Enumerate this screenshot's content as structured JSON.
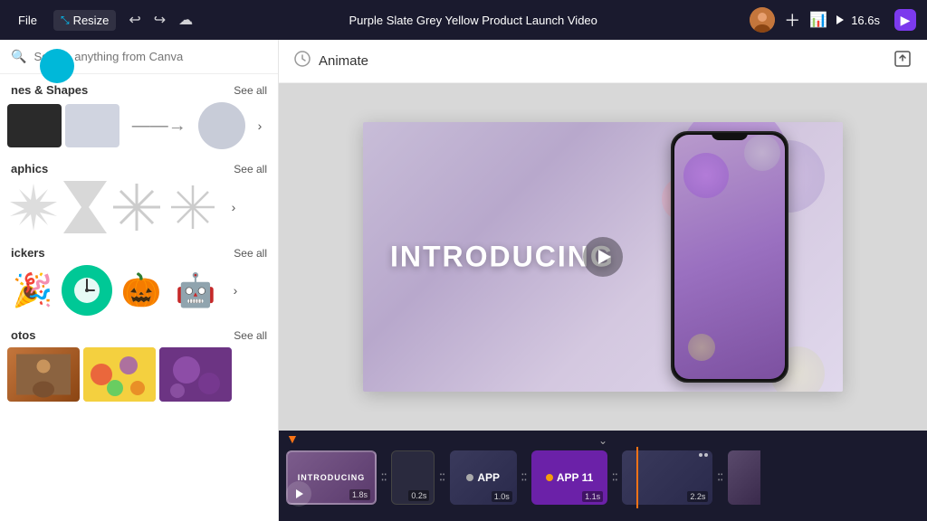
{
  "topbar": {
    "file_label": "File",
    "resize_label": "Resize",
    "title": "Purple Slate Grey Yellow Product Launch Video",
    "duration": "16.6s",
    "play_label": "▶",
    "share_icon": "↑□",
    "purple_btn_label": ""
  },
  "sidebar": {
    "search_placeholder": "Search anything from Canva",
    "sections": [
      {
        "id": "lines-shapes",
        "title": "nes & Shapes",
        "see_all": "See all"
      },
      {
        "id": "graphics",
        "title": "aphics",
        "see_all": "See all"
      },
      {
        "id": "stickers",
        "title": "ickers",
        "see_all": "See all"
      },
      {
        "id": "photos",
        "title": "otos",
        "see_all": "See all"
      }
    ]
  },
  "animate": {
    "label": "Animate"
  },
  "canvas": {
    "slide_text": "INTRODUCING"
  },
  "timeline": {
    "clips": [
      {
        "id": "clip1",
        "label": "INTRODUCING",
        "duration": "1.8s"
      },
      {
        "id": "clip2",
        "label": "",
        "duration": "0.2s"
      },
      {
        "id": "clip3",
        "label": "APP",
        "duration": "1.0s"
      },
      {
        "id": "clip4",
        "label": "APP 11",
        "duration": "1.1s"
      },
      {
        "id": "clip5",
        "label": "",
        "duration": "2.2s"
      }
    ]
  }
}
